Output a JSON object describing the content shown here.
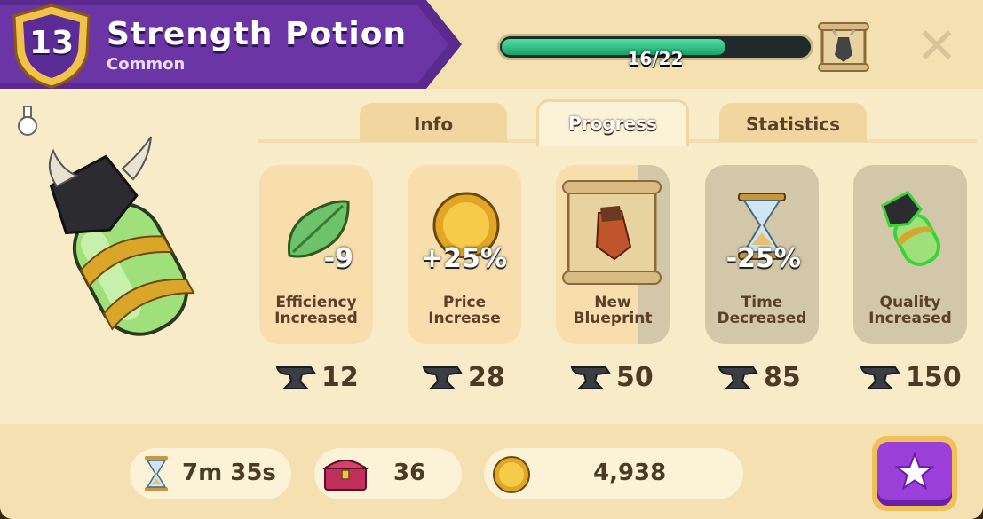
{
  "header": {
    "level": "13",
    "title": "Strength Potion",
    "rarity": "Common",
    "progress_text": "16/22",
    "progress_fraction": 0.7273
  },
  "tabs": [
    {
      "label": "Info",
      "active": false
    },
    {
      "label": "Progress",
      "active": true
    },
    {
      "label": "Statistics",
      "active": false
    }
  ],
  "rewards": [
    {
      "value": "-9",
      "label_line1": "Efficiency",
      "label_line2": "Increased",
      "cost": "12",
      "icon": "leaf-icon"
    },
    {
      "value": "+25%",
      "label_line1": "Price",
      "label_line2": "Increase",
      "cost": "28",
      "icon": "coin-icon"
    },
    {
      "value": "",
      "label_line1": "New",
      "label_line2": "Blueprint",
      "cost": "50",
      "icon": "blueprint-scroll-icon"
    },
    {
      "value": "-25%",
      "label_line1": "Time",
      "label_line2": "Decreased",
      "cost": "85",
      "icon": "hourglass-icon"
    },
    {
      "value": "",
      "label_line1": "Quality",
      "label_line2": "Increased",
      "cost": "150",
      "icon": "quality-potion-icon"
    }
  ],
  "footer": {
    "craft_time": "7m 35s",
    "chest_count": "36",
    "gold": "4,938"
  },
  "colors": {
    "header_purple": "#6c35a6",
    "panel_bg": "#f8ecc8",
    "progress_green": "#2fc47e",
    "star_button": "#9a3fd8"
  }
}
